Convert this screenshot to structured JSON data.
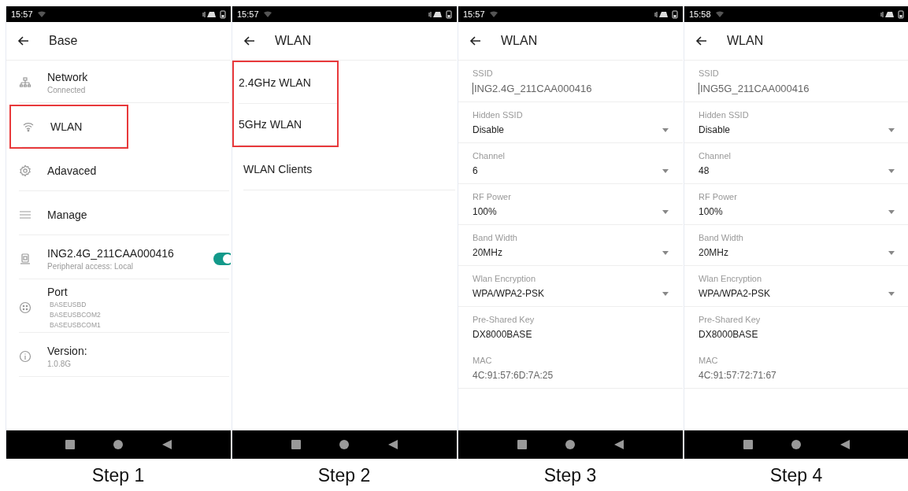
{
  "screens": [
    {
      "kind": "menu",
      "status_time": "15:57",
      "title": "Base",
      "caption": "Step 1",
      "items": [
        {
          "kind": "plain",
          "title": "Network",
          "subtitle": [
            "Connected"
          ],
          "highlighted": false
        },
        {
          "kind": "plain",
          "title": "WLAN",
          "highlighted": true
        },
        {
          "kind": "plain",
          "title": "Adavaced",
          "highlighted": false
        },
        {
          "kind": "plain",
          "title": "Manage",
          "highlighted": false
        },
        {
          "kind": "toggle",
          "title": "ING2.4G_211CAA000416",
          "subtitle": [
            "Peripheral access: Local"
          ],
          "on": true,
          "highlighted": false
        },
        {
          "kind": "plain",
          "title": "Port",
          "details": [
            "BASEUSBD",
            "BASEUSBCOM2",
            "BASEUSBCOM1"
          ],
          "highlighted": false
        },
        {
          "kind": "plain",
          "title": "Version:",
          "subtitle": [
            "1.0.8G"
          ],
          "highlighted": false
        }
      ]
    },
    {
      "kind": "list",
      "status_time": "15:57",
      "title": "WLAN",
      "caption": "Step 2",
      "items": [
        {
          "title": "2.4GHz WLAN",
          "highlighted": true
        },
        {
          "title": "5GHz WLAN",
          "highlighted": true
        },
        {
          "title": "WLAN Clients",
          "highlighted": false
        }
      ]
    },
    {
      "kind": "form",
      "status_time": "15:57",
      "title": "WLAN",
      "caption": "Step 3",
      "fields": [
        {
          "kind": "input",
          "label": "SSID",
          "value": "ING2.4G_211CAA000416"
        },
        {
          "kind": "select",
          "label": "Hidden SSID",
          "value": "Disable"
        },
        {
          "kind": "select",
          "label": "Channel",
          "value": "6"
        },
        {
          "kind": "select",
          "label": "RF Power",
          "value": "100%"
        },
        {
          "kind": "select",
          "label": "Band Width",
          "value": "20MHz"
        },
        {
          "kind": "select",
          "label": "Wlan Encryption",
          "value": "WPA/WPA2-PSK"
        },
        {
          "kind": "text",
          "label": "Pre-Shared Key",
          "value": "DX8000BASE"
        },
        {
          "kind": "readonly",
          "label": "MAC",
          "value": "4C:91:57:6D:7A:25"
        }
      ]
    },
    {
      "kind": "form",
      "status_time": "15:58",
      "title": "WLAN",
      "caption": "Step 4",
      "fields": [
        {
          "kind": "input",
          "label": "SSID",
          "value": "ING5G_211CAA000416"
        },
        {
          "kind": "select",
          "label": "Hidden SSID",
          "value": "Disable"
        },
        {
          "kind": "select",
          "label": "Channel",
          "value": "48"
        },
        {
          "kind": "select",
          "label": "RF Power",
          "value": "100%"
        },
        {
          "kind": "select",
          "label": "Band Width",
          "value": "20MHz"
        },
        {
          "kind": "select",
          "label": "Wlan Encryption",
          "value": "WPA/WPA2-PSK"
        },
        {
          "kind": "text",
          "label": "Pre-Shared Key",
          "value": "DX8000BASE"
        },
        {
          "kind": "readonly",
          "label": "MAC",
          "value": "4C:91:57:72:71:67"
        }
      ]
    }
  ]
}
